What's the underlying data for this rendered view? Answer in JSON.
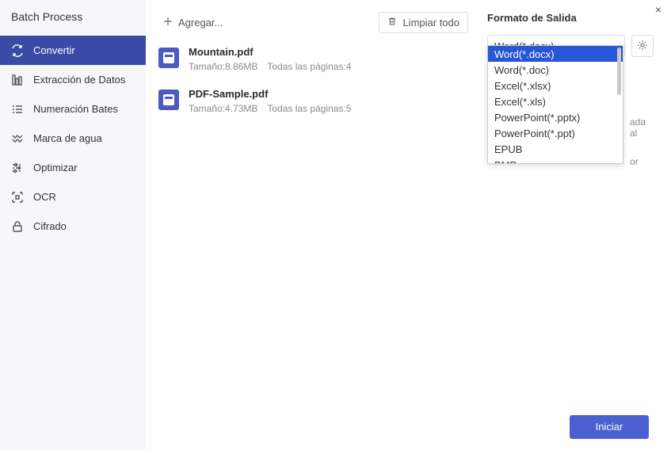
{
  "close_icon": "×",
  "sidebar": {
    "title": "Batch Process",
    "items": [
      {
        "label": "Convertir",
        "icon": "convert"
      },
      {
        "label": "Extracción de Datos",
        "icon": "extract"
      },
      {
        "label": "Numeración Bates",
        "icon": "bates"
      },
      {
        "label": "Marca de agua",
        "icon": "watermark"
      },
      {
        "label": "Optimizar",
        "icon": "optimize"
      },
      {
        "label": "OCR",
        "icon": "ocr"
      },
      {
        "label": "Cifrado",
        "icon": "lock"
      }
    ]
  },
  "toolbar": {
    "add_label": "Agregar...",
    "clear_label": "Limpiar todo"
  },
  "files": [
    {
      "name": "Mountain.pdf",
      "size": "Tamaño:8.86MB",
      "pages": "Todas las páginas:4"
    },
    {
      "name": "PDF-Sample.pdf",
      "size": "Tamaño:4.73MB",
      "pages": "Todas las páginas:5"
    }
  ],
  "output": {
    "title": "Formato de Salida",
    "selected": "Word(*.docx)",
    "options": [
      "Word(*.docx)",
      "Word(*.doc)",
      "Excel(*.xlsx)",
      "Excel(*.xls)",
      "PowerPoint(*.pptx)",
      "PowerPoint(*.ppt)",
      "EPUB",
      "BMP"
    ],
    "hint1": "ada al",
    "hint2": "or"
  },
  "footer": {
    "start_label": "Iniciar"
  }
}
